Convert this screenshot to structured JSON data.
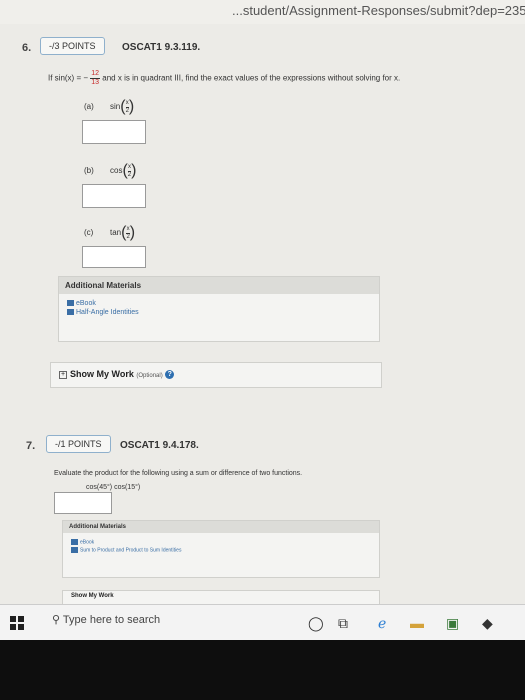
{
  "browser": {
    "url": "...student/Assignment-Responses/submit?dep=23546164&ta"
  },
  "q6": {
    "number": "6.",
    "points": "-/3 POINTS",
    "code": "OSCAT1 9.3.119.",
    "prompt_start": "If sin(x) = −",
    "frac_num": "12",
    "frac_den": "13",
    "prompt_end": "and x is in quadrant III, find the exact values of the expressions without solving for x.",
    "parts": [
      {
        "label": "(a)",
        "func": "sin"
      },
      {
        "label": "(b)",
        "func": "cos"
      },
      {
        "label": "(c)",
        "func": "tan"
      }
    ],
    "arg_num": "x",
    "arg_den": "2",
    "materials_title": "Additional Materials",
    "materials": [
      "eBook",
      "Half-Angle Identities"
    ],
    "show_work": "Show My Work",
    "optional": "(Optional)"
  },
  "q7": {
    "number": "7.",
    "points": "-/1 POINTS",
    "code": "OSCAT1 9.4.178.",
    "prompt": "Evaluate the product for the following using a sum or difference of two functions.",
    "expression": "cos(45°) cos(15°)",
    "materials_title": "Additional Materials",
    "materials": [
      "eBook",
      "Sum to Product and Product to Sum Identities"
    ],
    "show_work": "Show My Work"
  },
  "taskbar": {
    "search_placeholder": "Type here to search"
  }
}
